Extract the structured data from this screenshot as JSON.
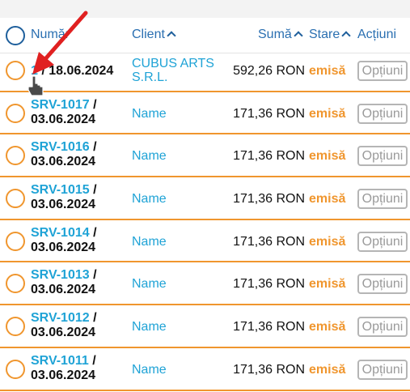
{
  "header": {
    "number_label": "Număr",
    "client_label": "Client",
    "sum_label": "Sumă",
    "state_label": "Stare",
    "actions_label": "Acțiuni"
  },
  "rows": [
    {
      "code": "1",
      "date": "18.06.2024",
      "client": "CUBUS ARTS S.R.L.",
      "client_line1": "CUBUS ARTS",
      "client_line2": "S.R.L.",
      "sum": "592,26 RON",
      "status": "emisă",
      "options": "Opțiuni"
    },
    {
      "code": "SRV-1017",
      "date": "03.06.2024",
      "client": "Name",
      "sum": "171,36 RON",
      "status": "emisă",
      "options": "Opțiuni"
    },
    {
      "code": "SRV-1016",
      "date": "03.06.2024",
      "client": "Name",
      "sum": "171,36 RON",
      "status": "emisă",
      "options": "Opțiuni"
    },
    {
      "code": "SRV-1015",
      "date": "03.06.2024",
      "client": "Name",
      "sum": "171,36 RON",
      "status": "emisă",
      "options": "Opțiuni"
    },
    {
      "code": "SRV-1014",
      "date": "03.06.2024",
      "client": "Name",
      "sum": "171,36 RON",
      "status": "emisă",
      "options": "Opțiuni"
    },
    {
      "code": "SRV-1013",
      "date": "03.06.2024",
      "client": "Name",
      "sum": "171,36 RON",
      "status": "emisă",
      "options": "Opțiuni"
    },
    {
      "code": "SRV-1012",
      "date": "03.06.2024",
      "client": "Name",
      "sum": "171,36 RON",
      "status": "emisă",
      "options": "Opțiuni"
    },
    {
      "code": "SRV-1011",
      "date": "03.06.2024",
      "client": "Name",
      "sum": "171,36 RON",
      "status": "emisă",
      "options": "Opțiuni"
    }
  ],
  "colors": {
    "accent_orange": "#f0962e",
    "link_blue": "#1fa3d6",
    "header_blue": "#2a6fb1",
    "annotation_red": "#e02020"
  },
  "icons": {
    "select_all": "circle-outline-icon",
    "row_select": "circle-outline-icon",
    "sort": "chevron-up-icon",
    "annotation": "red-arrow-icon",
    "pointer": "hand-cursor-icon"
  }
}
